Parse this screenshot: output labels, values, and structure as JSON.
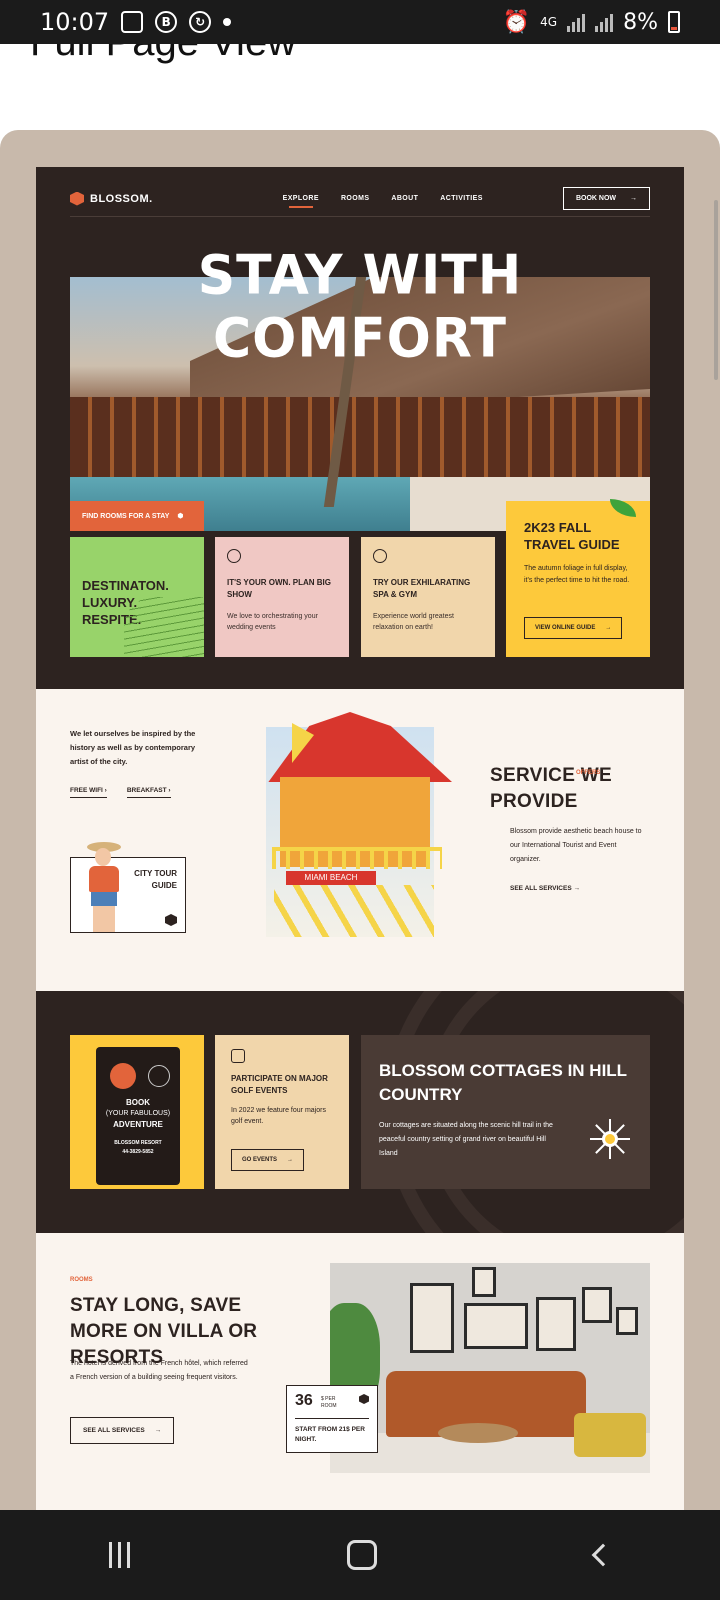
{
  "status": {
    "time": "10:07",
    "battery": "8%",
    "network": "4G"
  },
  "page_title": "Full Page View",
  "site": {
    "brand": "BLOSSOM.",
    "nav": [
      "EXPLORE",
      "ROOMS",
      "ABOUT",
      "ACTIVITIES"
    ],
    "book_now": "BOOK NOW",
    "hero_title": "STAY WITH COMFORT",
    "find_rooms": "FIND ROOMS FOR A STAY",
    "card1": "DESTINATON. LUXURY. RESPITE.",
    "card2": {
      "title": "IT'S YOUR OWN. PLAN BIG SHOW",
      "text": "We love to orchestrating your wedding events"
    },
    "card3": {
      "title": "TRY OUR EXHILARATING SPA & GYM",
      "text": "Experience world greatest relaxation on earth!"
    },
    "guide": {
      "title": "2K23 FALL TRAVEL GUIDE",
      "text": "The autumn foliage in full display, it's the perfect time to hit the road.",
      "button": "VIEW ONLINE GUIDE"
    },
    "inspired": "We let ourselves be inspired by the history as well as by contemporary artist of the city.",
    "link_wifi": "FREE WIFI",
    "link_breakfast": "BREAKFAST",
    "city_tour": "CITY TOUR GUIDE",
    "tower_sign": "MIAMI BEACH",
    "service": {
      "title": "SERVICE WE PROVIDE",
      "tag": "OFFERS",
      "text": "Blossom provide aesthetic beach house to our International Tourist and Event organizer.",
      "link": "SEE ALL SERVICES"
    },
    "board": {
      "line1": "BOOK",
      "line2": "(YOUR FABULOUS)",
      "line3": "ADVENTURE",
      "footer1": "BLOSSOM RESORT",
      "footer2": "44-3829-5852"
    },
    "golf": {
      "title": "PARTICIPATE ON MAJOR GOLF EVENTS",
      "text": "In 2022 we feature four majors golf event.",
      "button": "GO EVENTS"
    },
    "cottages": {
      "title": "BLOSSOM COTTAGES IN HILL COUNTRY",
      "text": "Our cottages are situated along the scenic hill trail in the peaceful country setting of grand river on beautiful Hill Island"
    },
    "rooms": {
      "tag": "ROOMS",
      "title": "STAY LONG, SAVE MORE ON VILLA OR RESORTS",
      "text": "The hotel is derived from the French hôtel, which referred a French version of a building seeing frequent visitors.",
      "button": "SEE ALL SERVICES"
    },
    "price": {
      "amount": "36",
      "unit": "$ PER ROOM",
      "from": "START FROM 21$ PER NIGHT."
    }
  },
  "colors": {
    "dark": "#2d2320",
    "accent": "#e2643b",
    "yellow": "#fdc93b",
    "green": "#98d36a",
    "pink": "#f0c8c4",
    "sand": "#f1d6ab",
    "cream": "#faf4ee"
  }
}
